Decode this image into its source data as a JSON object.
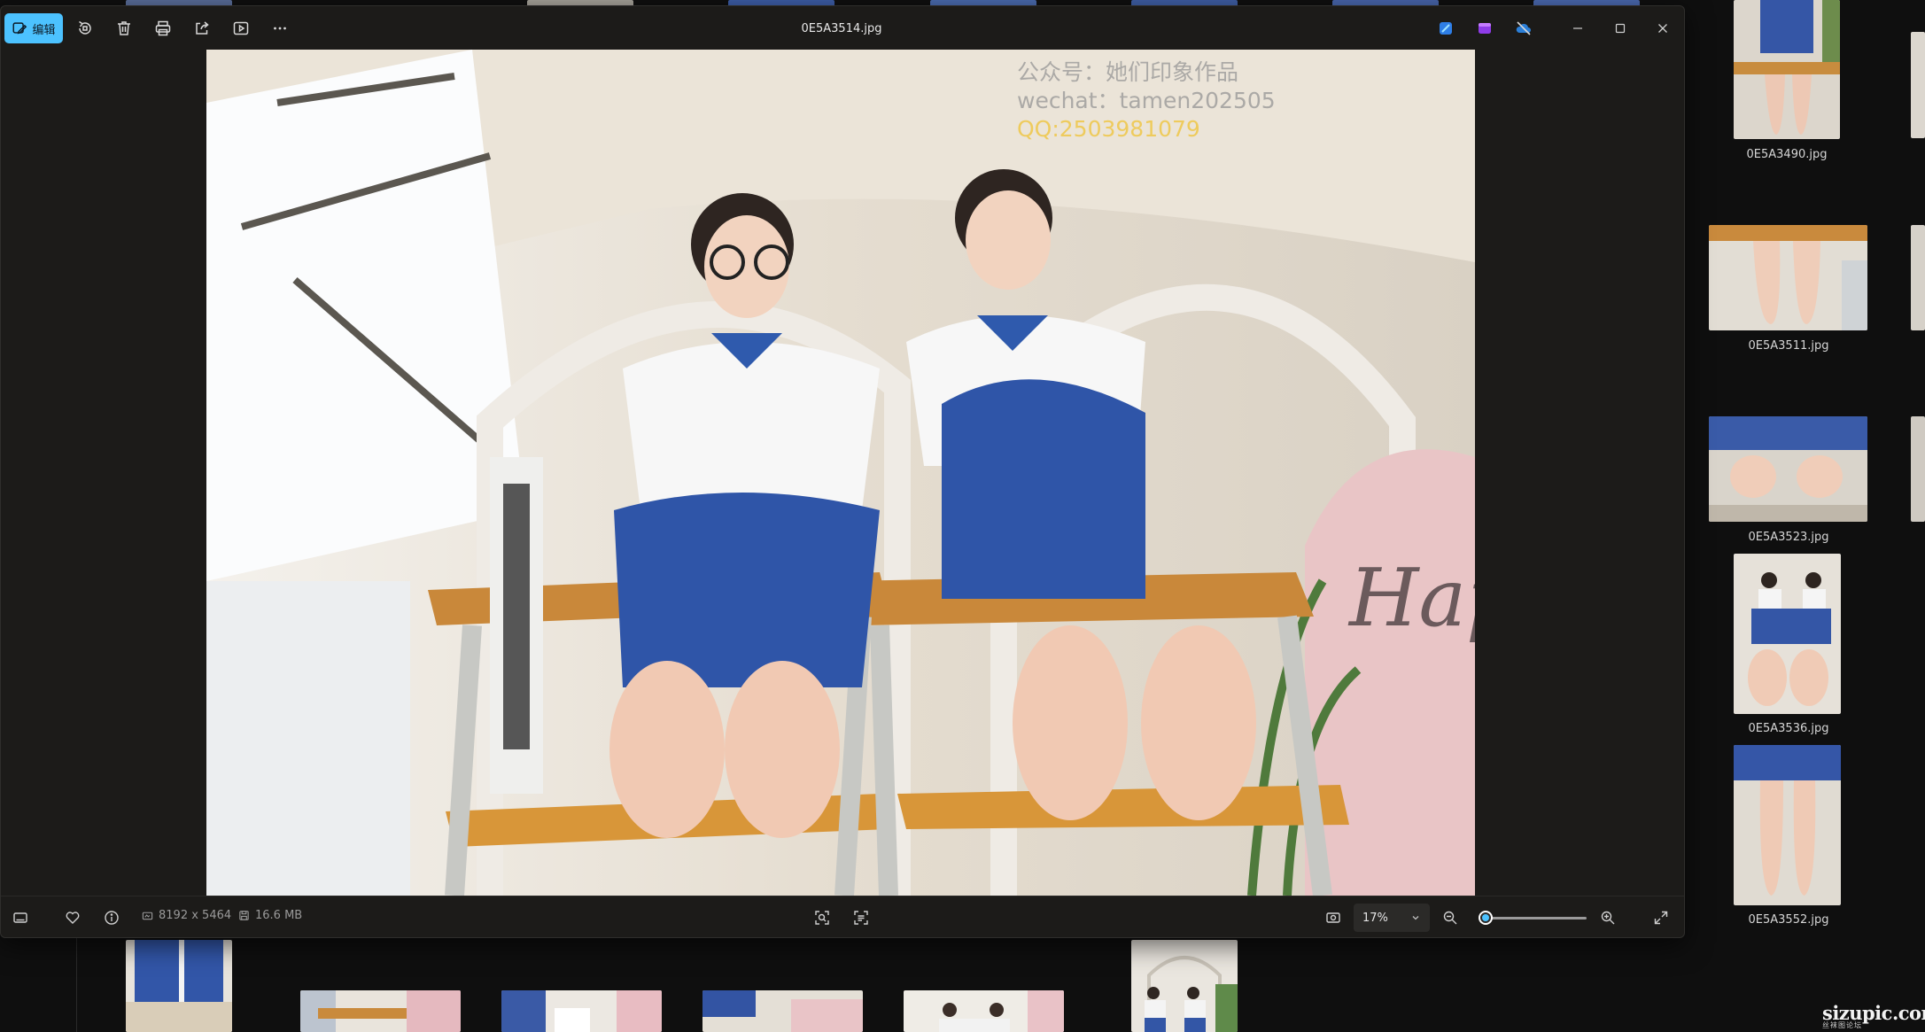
{
  "window": {
    "filename": "0E5A3514.jpg",
    "edit_label": "编辑"
  },
  "watermark": {
    "line1": "公众号：她们印象作品",
    "line2": "wechat：tamen202505",
    "line3": "QQ:2503981079"
  },
  "photo_art": {
    "text": "Happ"
  },
  "status": {
    "dimensions": "8192 x 5464",
    "filesize": "16.6 MB",
    "zoom": "17%",
    "zoom_fraction": 0.05
  },
  "thumbnails": [
    {
      "label": "0E5A3490.jpg"
    },
    {
      "label": "0E5A3511.jpg"
    },
    {
      "label": "0E5A3523.jpg"
    },
    {
      "label": "0E5A3536.jpg"
    },
    {
      "label": "0E5A3552.jpg"
    }
  ],
  "site_logo": {
    "name": "sizupic.com",
    "tagline": "丝袜图论坛"
  },
  "icons": {
    "edit": "edit-image-icon",
    "rotate": "rotate-icon",
    "delete": "trash-icon",
    "print": "print-icon",
    "share": "share-icon",
    "slideshow": "slideshow-icon",
    "more": "more-icon",
    "designer": "designer-icon",
    "clipchamp": "clipchamp-icon",
    "onedrive": "cloud-off-icon"
  },
  "colors": {
    "accent": "#4cc2ff",
    "window_bg": "#1c1b19",
    "qq_text": "#eec850"
  }
}
